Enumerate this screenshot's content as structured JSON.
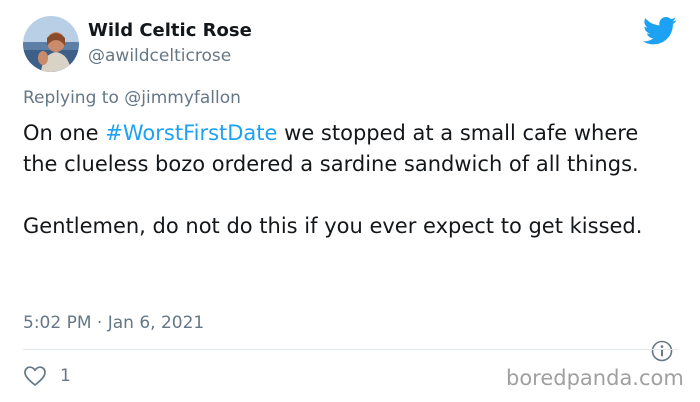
{
  "author": {
    "name": "Wild Celtic Rose",
    "handle": "@awildcelticrose"
  },
  "reply": {
    "prefix": "Replying to",
    "mention": "@jimmyfallon"
  },
  "tweet": {
    "p1_before": "On one ",
    "hashtag": "#WorstFirstDate",
    "p1_after": " we stopped at a small cafe where the clueless bozo ordered a sardine sandwich of all things.",
    "p2": "Gentlemen, do not do this if you ever expect to get kissed."
  },
  "meta": {
    "time": "5:02 PM",
    "separator": " · ",
    "date": "Jan 6, 2021"
  },
  "actions": {
    "like_count": "1"
  },
  "watermark": "boredpanda.com",
  "icons": {
    "brand": "twitter-bird-icon",
    "info": "info-icon",
    "like": "heart-icon"
  },
  "colors": {
    "accent": "#1da1f2",
    "secondary_text": "#657786",
    "primary_text": "#14171a",
    "divider": "#e1e8ed"
  }
}
